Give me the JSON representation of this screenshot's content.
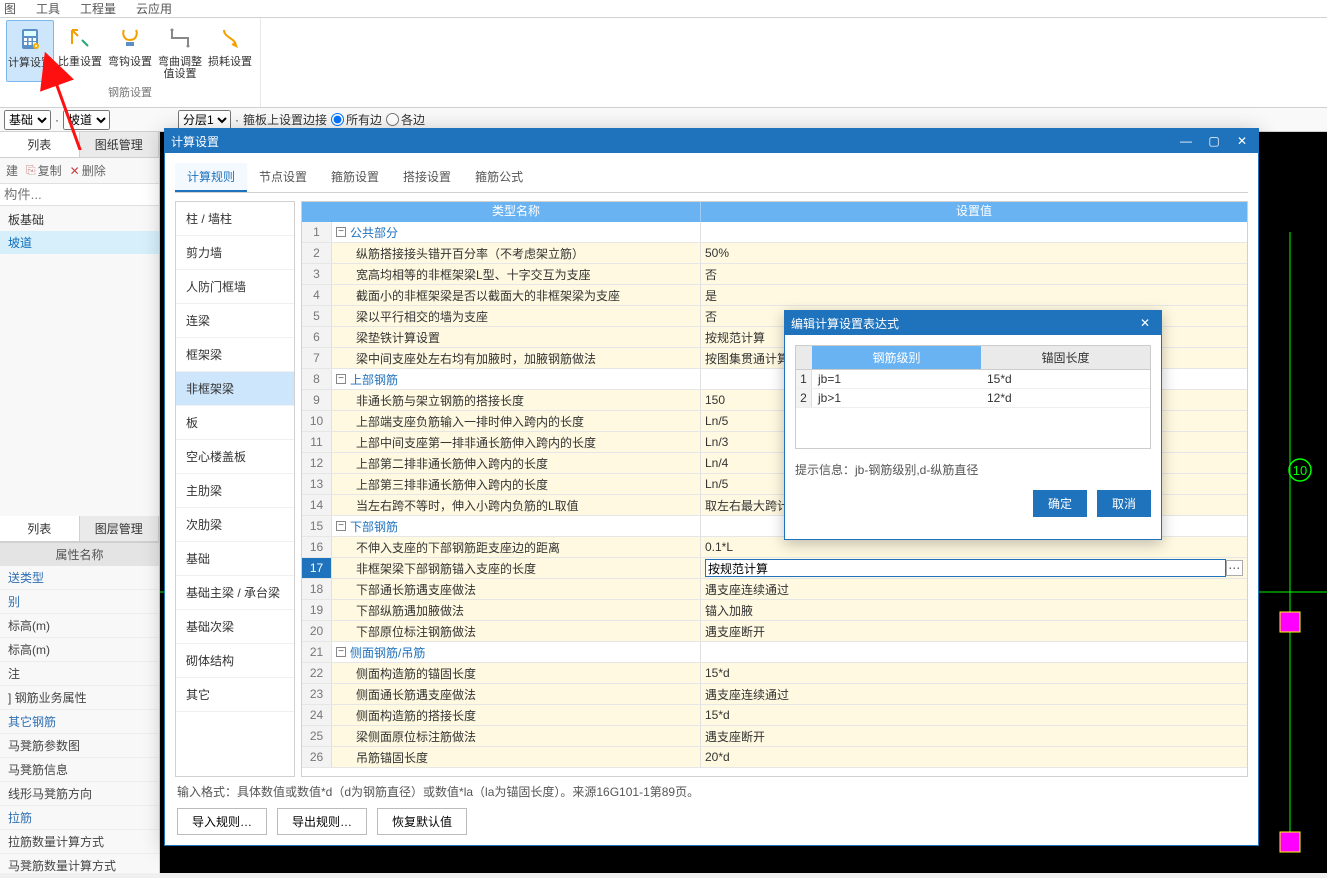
{
  "topmenu": [
    "图",
    "工具",
    "工程量",
    "云应用"
  ],
  "ribbon": {
    "buttons": [
      {
        "label": "计算设置",
        "active": true
      },
      {
        "label": "比重设置"
      },
      {
        "label": "弯钩设置"
      },
      {
        "label": "弯曲调整值设置"
      },
      {
        "label": "损耗设置"
      }
    ],
    "group_label": "钢筋设置"
  },
  "secbar": {
    "sel1": "基础",
    "sel2": "坡道",
    "sel3": "分层1",
    "checkbox": "箍板上设置边接",
    "radio1": "所有边",
    "radio2": "各边"
  },
  "left": {
    "tabs": [
      "列表",
      "图纸管理"
    ],
    "toolbar": {
      "new": "建",
      "copy": "复制",
      "delete": "删除"
    },
    "filter_placeholder": "构件...",
    "tree": [
      "板基础",
      "坡道"
    ],
    "tabs2": [
      "列表",
      "图层管理"
    ],
    "prop_header": "属性名称",
    "props": [
      {
        "t": "送类型",
        "blue": true
      },
      {
        "t": "别",
        "blue": true
      },
      {
        "t": "标高(m)"
      },
      {
        "t": "标高(m)"
      },
      {
        "t": "注"
      },
      {
        "t": "] 钢筋业务属性",
        "blue": false
      },
      {
        "t": "其它钢筋",
        "blue": true
      },
      {
        "t": "马凳筋参数图"
      },
      {
        "t": "马凳筋信息"
      },
      {
        "t": "线形马凳筋方向"
      },
      {
        "t": "拉筋",
        "blue": true
      },
      {
        "t": "拉筋数量计算方式"
      },
      {
        "t": "马凳筋数量计算方式"
      }
    ]
  },
  "dialog": {
    "title": "计算设置",
    "tabs": [
      "计算规则",
      "节点设置",
      "箍筋设置",
      "搭接设置",
      "箍筋公式"
    ],
    "categories": [
      "柱 / 墙柱",
      "剪力墙",
      "人防门框墙",
      "连梁",
      "框架梁",
      "非框架梁",
      "板",
      "空心楼盖板",
      "主肋梁",
      "次肋梁",
      "基础",
      "基础主梁 / 承台梁",
      "基础次梁",
      "砌体结构",
      "其它"
    ],
    "active_cat": "非框架梁",
    "head": {
      "name": "类型名称",
      "val": "设置值"
    },
    "rows": [
      {
        "n": 1,
        "section": true,
        "name": "公共部分",
        "val": ""
      },
      {
        "n": 2,
        "name": "纵筋搭接接头错开百分率（不考虑架立筋）",
        "val": "50%"
      },
      {
        "n": 3,
        "name": "宽高均相等的非框架梁L型、十字交互为支座",
        "val": "否"
      },
      {
        "n": 4,
        "name": "截面小的非框架梁是否以截面大的非框架梁为支座",
        "val": "是"
      },
      {
        "n": 5,
        "name": "梁以平行相交的墙为支座",
        "val": "否"
      },
      {
        "n": 6,
        "name": "梁垫铁计算设置",
        "val": "按规范计算"
      },
      {
        "n": 7,
        "name": "梁中间支座处左右均有加腋时，加腋钢筋做法",
        "val": "按图集贯通计算"
      },
      {
        "n": 8,
        "section": true,
        "name": "上部钢筋",
        "val": ""
      },
      {
        "n": 9,
        "name": "非通长筋与架立钢筋的搭接长度",
        "val": "150"
      },
      {
        "n": 10,
        "name": "上部端支座负筋输入一排时伸入跨内的长度",
        "val": "Ln/5"
      },
      {
        "n": 11,
        "name": "上部中间支座第一排非通长筋伸入跨内的长度",
        "val": "Ln/3"
      },
      {
        "n": 12,
        "name": "上部第二排非通长筋伸入跨内的长度",
        "val": "Ln/4"
      },
      {
        "n": 13,
        "name": "上部第三排非通长筋伸入跨内的长度",
        "val": "Ln/5"
      },
      {
        "n": 14,
        "name": "当左右跨不等时，伸入小跨内负筋的L取值",
        "val": "取左右最大跨计算"
      },
      {
        "n": 15,
        "section": true,
        "name": "下部钢筋",
        "val": ""
      },
      {
        "n": 16,
        "name": "不伸入支座的下部钢筋距支座边的距离",
        "val": "0.1*L"
      },
      {
        "n": 17,
        "sel": true,
        "name": "非框架梁下部钢筋锚入支座的长度",
        "val": "按规范计算"
      },
      {
        "n": 18,
        "name": "下部通长筋遇支座做法",
        "val": "遇支座连续通过"
      },
      {
        "n": 19,
        "name": "下部纵筋遇加腋做法",
        "val": "锚入加腋"
      },
      {
        "n": 20,
        "name": "下部原位标注钢筋做法",
        "val": "遇支座断开"
      },
      {
        "n": 21,
        "section": true,
        "name": "侧面钢筋/吊筋",
        "val": ""
      },
      {
        "n": 22,
        "name": "侧面构造筋的锚固长度",
        "val": "15*d"
      },
      {
        "n": 23,
        "name": "侧面通长筋遇支座做法",
        "val": "遇支座连续通过"
      },
      {
        "n": 24,
        "name": "侧面构造筋的搭接长度",
        "val": "15*d"
      },
      {
        "n": 25,
        "name": "梁侧面原位标注筋做法",
        "val": "遇支座断开"
      },
      {
        "n": 26,
        "name": "吊筋锚固长度",
        "val": "20*d"
      }
    ],
    "footer_hint": "输入格式：具体数值或数值*d（d为钢筋直径）或数值*la（la为锚固长度）。来源16G101-1第89页。",
    "buttons": {
      "import": "导入规则…",
      "export": "导出规则…",
      "restore": "恢复默认值"
    }
  },
  "subdialog": {
    "title": "编辑计算设置表达式",
    "headers": [
      "钢筋级别",
      "锚固长度"
    ],
    "rows": [
      {
        "n": 1,
        "a": "jb=1",
        "b": "15*d"
      },
      {
        "n": 2,
        "a": "jb>1",
        "b": "12*d"
      }
    ],
    "hint": "提示信息：jb-钢筋级别,d-纵筋直径",
    "ok": "确定",
    "cancel": "取消"
  },
  "canvas_label": "10"
}
